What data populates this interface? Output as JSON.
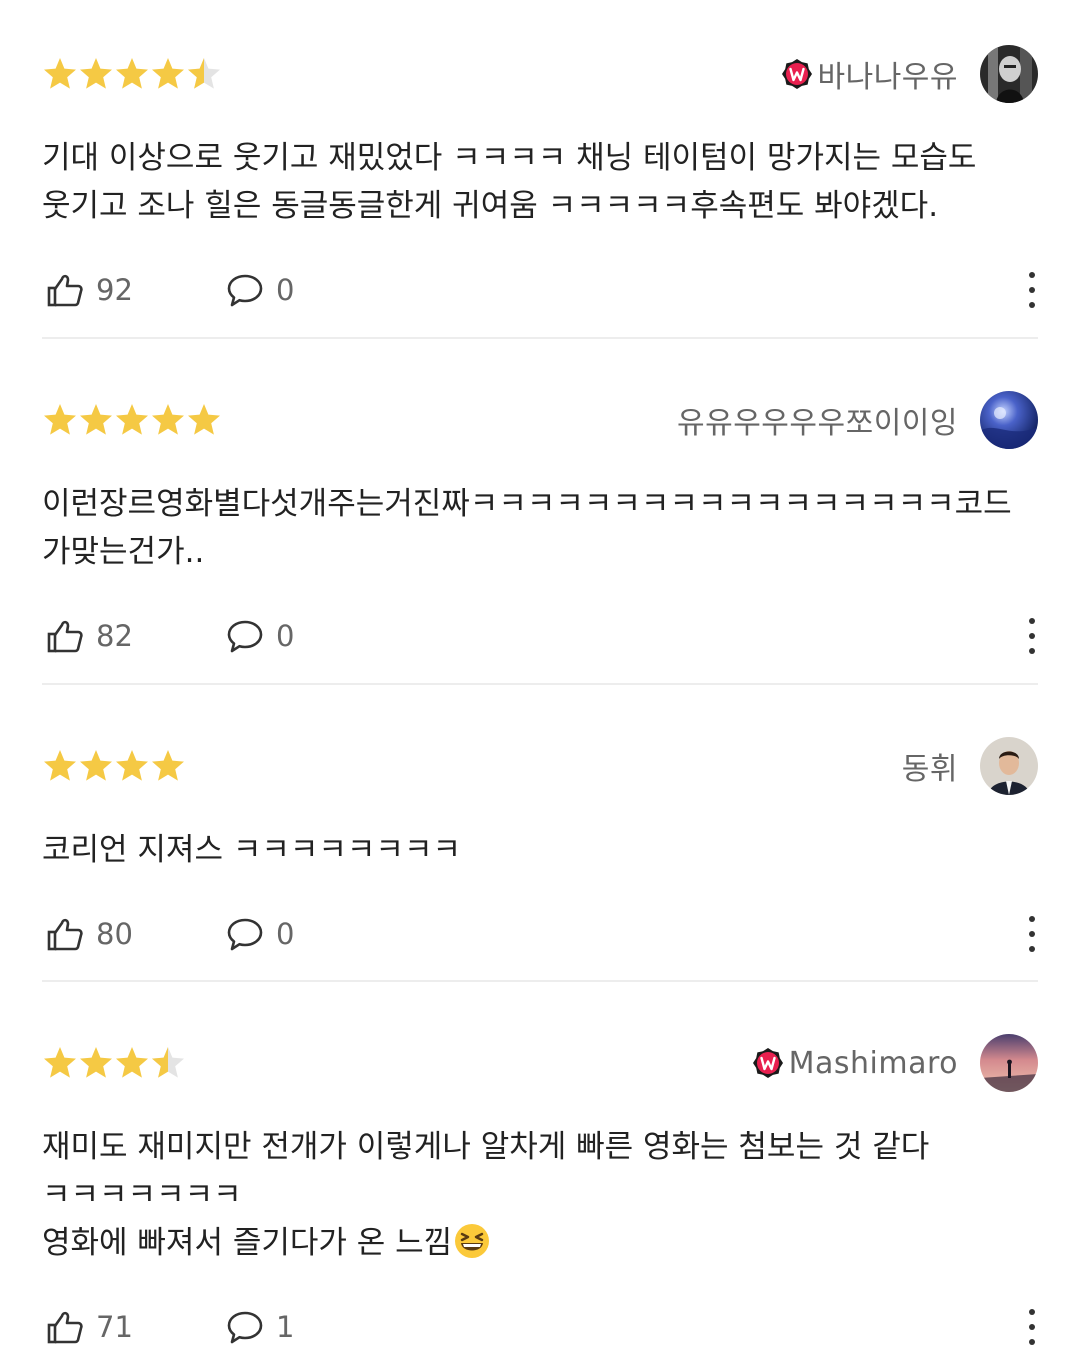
{
  "reviews": [
    {
      "rating": 4.5,
      "author": "바나나우유",
      "badge": "W",
      "avatar": "avatar-photo-bw-man",
      "lines": [
        "기대 이상으로 웃기고 재밌었다 ㅋㅋㅋㅋ 채닝 테이텀이 망가지는 모습도",
        "웃기고 조나 힐은 동글동글한게 귀여움 ㅋㅋㅋㅋㅋ후속편도 봐야겠다."
      ],
      "likes": "92",
      "comments": "0"
    },
    {
      "rating": 5,
      "author": "유유우우우우쪼이이잉",
      "badge": "",
      "avatar": "avatar-photo-blue-night",
      "lines": [
        "이런장르영화별다섯개주는거진짜ㅋㅋㅋㅋㅋㅋㅋㅋㅋㅋㅋㅋㅋㅋㅋㅋㅋ코드",
        "가맞는건가.."
      ],
      "likes": "82",
      "comments": "0"
    },
    {
      "rating": 4,
      "author": "동휘",
      "badge": "",
      "avatar": "avatar-photo-man-suit",
      "lines": [
        "코리언 지져스 ㅋㅋㅋㅋㅋㅋㅋㅋ"
      ],
      "likes": "80",
      "comments": "0"
    },
    {
      "rating": 3.5,
      "author": "Mashimaro",
      "badge": "W",
      "avatar": "avatar-photo-sunset",
      "lines": [
        "재미도 재미지만 전개가 이렇게나 알차게 빠른 영화는 첨보는 것 같다",
        "ㅋㅋㅋㅋㅋㅋㅋ",
        "영화에 빠져서 즐기다가 온 느낌"
      ],
      "emoji": "grinning-squinting-face-emoji",
      "likes": "71",
      "comments": "1"
    }
  ],
  "colors": {
    "star_filled": "#f5c944",
    "star_empty": "#e4e4e4",
    "badge_red": "#e8204f",
    "text": "#222222",
    "muted": "#666666",
    "divider": "#ededed"
  },
  "icons": {
    "like": "thumbs-up-icon",
    "comment": "speech-bubble-icon",
    "more": "more-vertical-icon"
  }
}
